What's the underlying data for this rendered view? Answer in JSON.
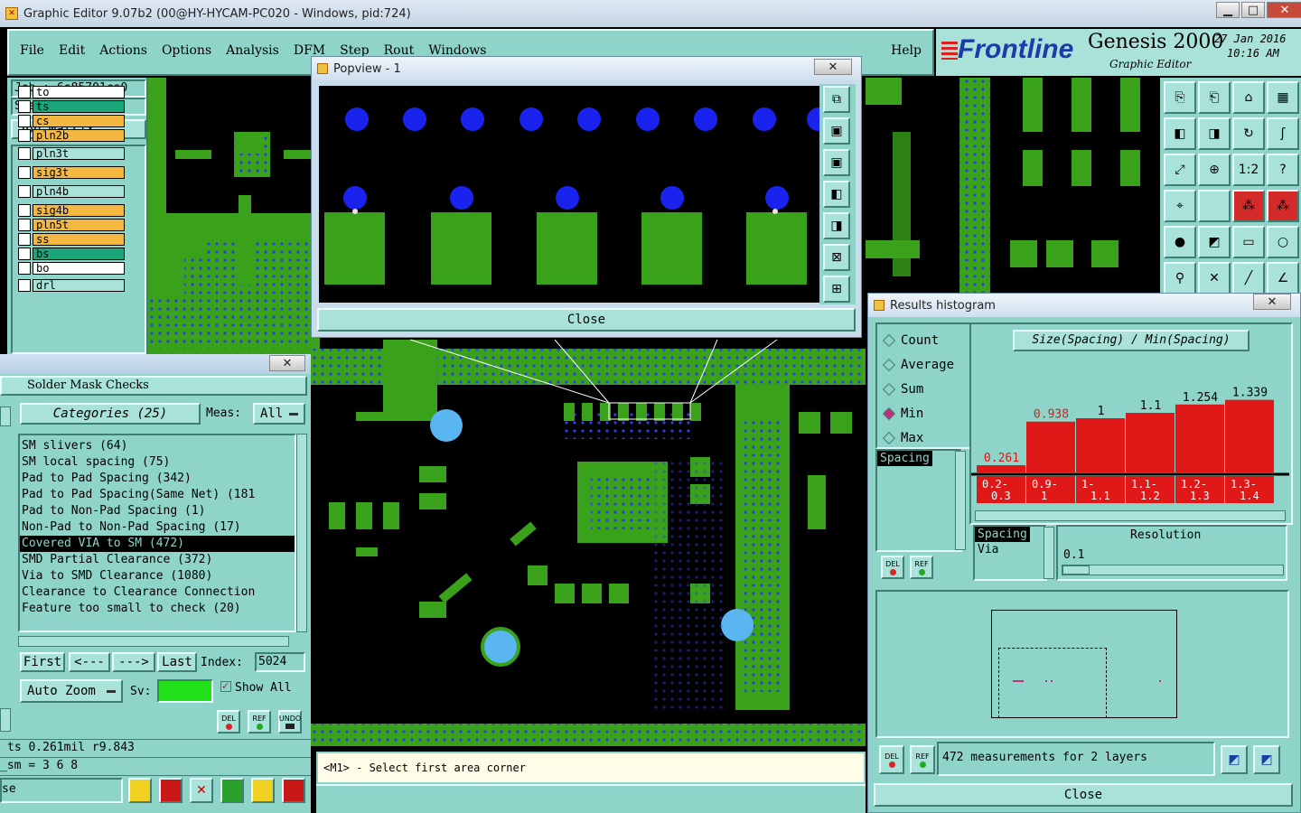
{
  "window_title": "Graphic Editor 9.07b2 (00@HY-HYCAM-PC020 - Windows, pid:724)",
  "menu": [
    "File",
    "Edit",
    "Actions",
    "Options",
    "Analysis",
    "DFM",
    "Step",
    "Rout",
    "Windows"
  ],
  "help_label": "Help",
  "brand": {
    "logo": "Frontline",
    "product": "Genesis 2000",
    "subtitle": "Graphic Editor",
    "date": "27 Jan 2016",
    "time": "10:16 AM"
  },
  "job": {
    "job_label": "Job : 6s85701ca0",
    "step_label": "Step: cam",
    "matrix_button": "Job Matrix ..."
  },
  "layers": [
    {
      "name": "to",
      "color": "#ffffff"
    },
    {
      "name": "ts",
      "color": "#1aa67a"
    },
    {
      "name": "cs",
      "color": "#f4b840"
    },
    {
      "name": "pln2b",
      "color": "#f4b840"
    },
    {
      "name": "pln3t",
      "color": "#a8e2d8"
    },
    {
      "name": "sig3t",
      "color": "#f4b840"
    },
    {
      "name": "pln4b",
      "color": "#a8e2d8"
    },
    {
      "name": "sig4b",
      "color": "#f4b840"
    },
    {
      "name": "pln5t",
      "color": "#f4b840"
    },
    {
      "name": "ss",
      "color": "#f4b840"
    },
    {
      "name": "bs",
      "color": "#1aa67a"
    },
    {
      "name": "bo",
      "color": "#ffffff"
    },
    {
      "name": "drl",
      "color": "#a8e2d8"
    }
  ],
  "popview": {
    "title": "Popview - 1",
    "close_label": "Close",
    "close_x": "✕"
  },
  "solder": {
    "header": "Solder Mask Checks",
    "categories_label": "Categories (25)",
    "meas_label": "Meas:",
    "meas_value": "All",
    "items": [
      "SM slivers (64)",
      "SM local spacing (75)",
      "Pad to Pad Spacing (342)",
      "Pad to Pad Spacing(Same Net) (181",
      "Pad to Non-Pad Spacing (1)",
      "Non-Pad to Non-Pad Spacing (17)",
      "Covered VIA to SM (472)",
      "SMD Partial Clearance (372)",
      "Via to SMD Clearance (1080)",
      "Clearance to Clearance Connection",
      "Feature too small to check (20)"
    ],
    "selected_index": 6,
    "nav": {
      "first": "First",
      "prev": "<---",
      "next": "--->",
      "last": "Last",
      "index_label": "Index:",
      "index_value": "5024"
    },
    "auto_zoom": "Auto Zoom",
    "sv_label": "Sv:",
    "show_all": "Show All",
    "btn_del": "DEL",
    "btn_ref": "REF",
    "btn_undo": "UNDO"
  },
  "status": {
    "line1": "ts 0.261mil  r9.843",
    "line2": "_sm = 3 6 8",
    "line3": "se",
    "prompt": "<M1> - Select first area corner"
  },
  "histogram": {
    "title": "Results histogram",
    "options": [
      {
        "label": "Count",
        "on": false
      },
      {
        "label": "Average",
        "on": false
      },
      {
        "label": "Sum",
        "on": false
      },
      {
        "label": "Min",
        "on": true
      },
      {
        "label": "Max",
        "on": false
      }
    ],
    "chart_title": "Size(Spacing) / Min(Spacing)",
    "list1": [
      "Spacing"
    ],
    "list2": [
      "Spacing",
      "Via"
    ],
    "resolution_label": "Resolution",
    "resolution_value": "0.1",
    "measure_text": "472 measurements for 2 layers",
    "close_label": "Close",
    "btn_del": "DEL",
    "btn_ref": "REF"
  },
  "chart_data": {
    "type": "bar",
    "title": "Size(Spacing) / Min(Spacing)",
    "categories": [
      "0.2-0.3",
      "0.9-1",
      "1-1.1",
      "1.1-1.2",
      "1.2-1.3",
      "1.3-1.4"
    ],
    "values": [
      0.261,
      0.938,
      1,
      1.1,
      1.254,
      1.339
    ],
    "bar_color": "#e01818",
    "ylim": [
      0,
      1.4
    ]
  },
  "colors": {
    "panel": "#8fd4c8",
    "copper": "#3aa21a",
    "via": "#2d3ee8",
    "bar": "#e01818"
  }
}
